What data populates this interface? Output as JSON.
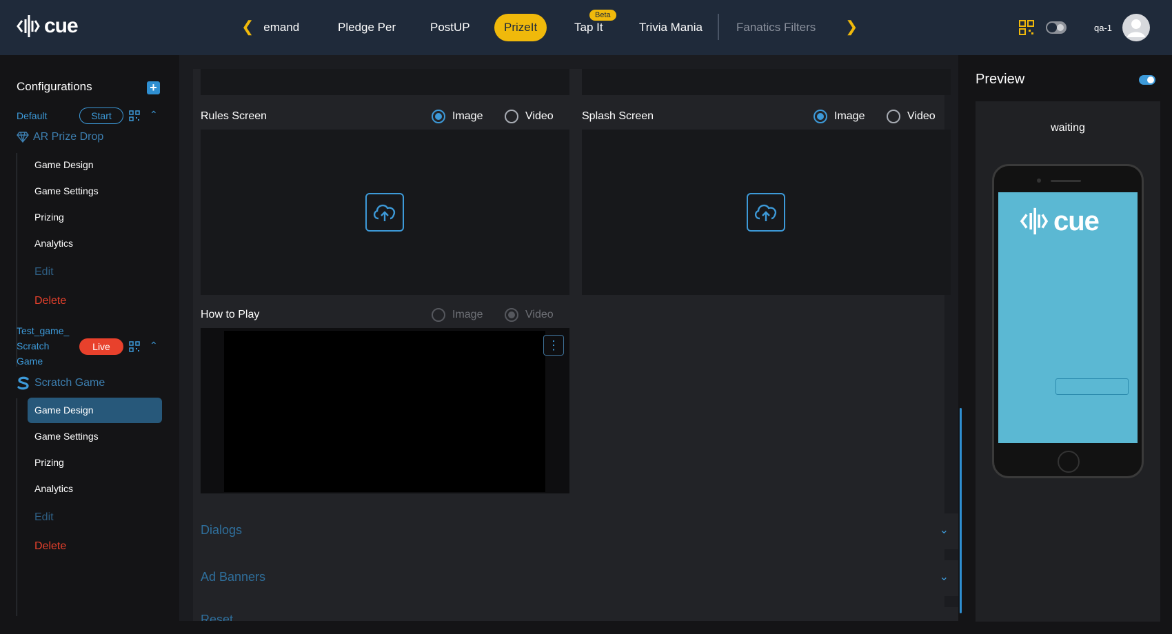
{
  "brand": {
    "name": "cue",
    "accent": "#f0b90b",
    "blue": "#3d9ad9",
    "danger": "#e8412c"
  },
  "header": {
    "tabs": [
      {
        "label": "Demand"
      },
      {
        "label": "Pledge Per"
      },
      {
        "label": "PostUP"
      },
      {
        "label": "PrizeIt",
        "active": true
      },
      {
        "label": "Tap It",
        "badge": "Beta"
      },
      {
        "label": "Trivia Mania"
      },
      {
        "label": "Fanatics Filters"
      }
    ],
    "user": "qa-1"
  },
  "sidebar": {
    "title": "Configurations",
    "configs": [
      {
        "name": "Default",
        "status": "Start",
        "game_type": "AR Prize Drop",
        "items": [
          "Game Design",
          "Game Settings",
          "Prizing",
          "Analytics",
          "Edit",
          "Delete"
        ]
      },
      {
        "name_lines": [
          "Test_game_",
          "Scratch",
          "Game"
        ],
        "status": "Live",
        "game_type": "Scratch Game",
        "items": [
          "Game Design",
          "Game Settings",
          "Prizing",
          "Analytics",
          "Edit",
          "Delete"
        ],
        "selected_item": "Game Design"
      }
    ]
  },
  "main": {
    "rules_screen": {
      "label": "Rules Screen",
      "image": "Image",
      "video": "Video",
      "selected": "Image"
    },
    "splash_screen": {
      "label": "Splash Screen",
      "image": "Image",
      "video": "Video",
      "selected": "Image"
    },
    "how_to_play": {
      "label": "How to Play",
      "image": "Image",
      "video": "Video",
      "selected": "Video"
    },
    "accordions": [
      "Dialogs",
      "Ad Banners",
      "Reset"
    ]
  },
  "preview": {
    "title": "Preview",
    "status": "waiting",
    "screen_color": "#5bb8d3"
  }
}
